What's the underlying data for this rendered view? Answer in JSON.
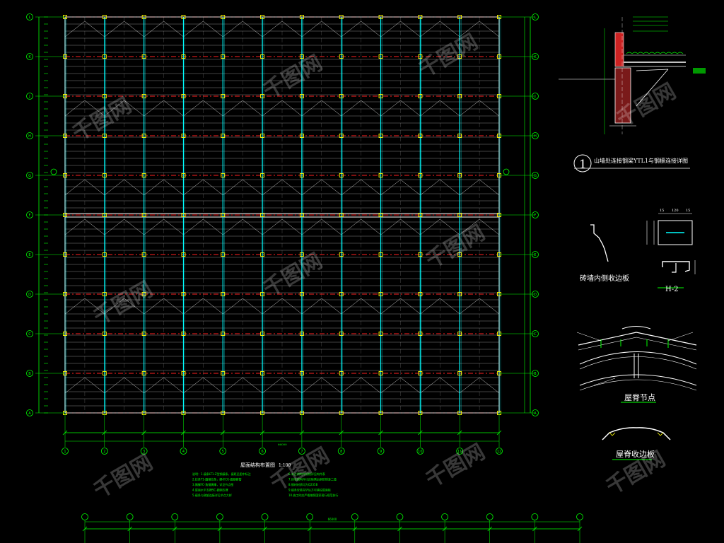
{
  "plan": {
    "title": "屋面结构布置图",
    "scale": "1:100",
    "row_axes": [
      "A",
      "B",
      "C",
      "D",
      "E",
      "F",
      "G",
      "H",
      "J",
      "K",
      "L"
    ],
    "column_axes": [
      "1",
      "2",
      "3",
      "4",
      "5",
      "6",
      "7",
      "8",
      "9",
      "10",
      "11",
      "12"
    ],
    "bottom_total": "66000",
    "notes": [
      "说明：1.檩条LT1-Z型钢檩条，檩距见图中标注",
      "2.拉条T1-圆钢拉条，撑杆CG-圆钢套管",
      "3.隅撑YC-角钢隅撑，详见节点图",
      "4.屋面水平支撑SC-圆钢支撑",
      "5.檩条与刚架连接详见节点大样",
      "6.未注明构件规格详见构件表",
      "7.所有钢构件均应除锈后刷防锈漆二道",
      "8.钢材材质均为Q235B",
      "9.檩条安装完毕后方可铺设屋面板",
      "10.施工时应严格按照国家现行规范执行"
    ]
  },
  "details": {
    "d1_title": "山墙处连接钢梁YTL1与钢檩连接详图",
    "d1_number": "1",
    "d2_title": "砖墙内侧收边板",
    "d3_label": "H-2",
    "d4_title": "屋脊节点",
    "d5_title": "屋脊收边板",
    "dims_h2": [
      "15",
      "120",
      "15"
    ]
  },
  "watermark": "千图网",
  "colors": {
    "background": "#000000",
    "dimension": "#00ff00",
    "purlin": "#ffffff",
    "rafter": "#00ffff",
    "beam": "#ff2020",
    "column": "#ffff00"
  }
}
